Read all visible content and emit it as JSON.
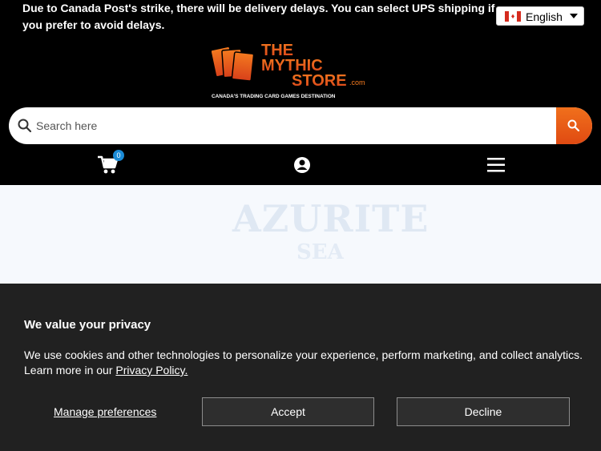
{
  "announcement": "Due to Canada Post's strike, there will be delivery delays. You can select UPS shipping if you prefer to avoid delays.",
  "language": {
    "selected": "English",
    "flag_icon": "canada-flag-icon"
  },
  "logo": {
    "line1": "THE",
    "line2": "MYTHIC",
    "line3": "STORE",
    "suffix": ".com",
    "tagline": "CANADA'S TRADING CARD GAMES DESTINATION"
  },
  "search": {
    "placeholder": "Search here",
    "icon": "search-icon",
    "button_icon": "search-icon"
  },
  "header_icons": {
    "cart_icon": "cart-icon",
    "cart_count": "0",
    "account_icon": "account-icon",
    "menu_icon": "hamburger-menu-icon"
  },
  "banner": {
    "title": "AZURITE",
    "subtitle": "SEA"
  },
  "cookie": {
    "title": "We value your privacy",
    "text": "We use cookies and other technologies to personalize your experience, perform marketing, and collect analytics. Learn more in our ",
    "link": "Privacy Policy.",
    "manage": "Manage preferences",
    "accept": "Accept",
    "decline": "Decline"
  },
  "colors": {
    "brand_orange": "#e85d16",
    "background": "#000000",
    "cookie_bg": "#212121",
    "badge": "#1a8ad6"
  }
}
